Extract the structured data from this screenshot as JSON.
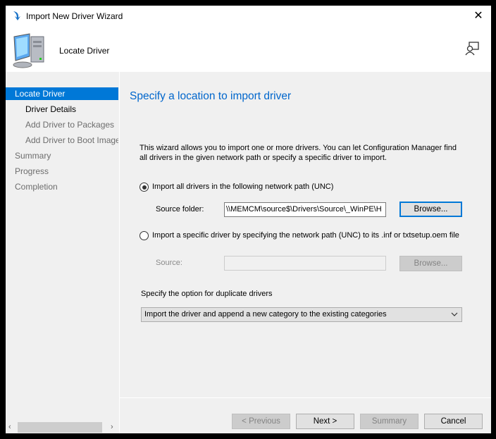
{
  "window": {
    "title": "Import New Driver Wizard",
    "close_icon": "close-icon"
  },
  "header": {
    "title": "Locate Driver",
    "feedback_icon": "feedback-icon"
  },
  "nav": {
    "items": [
      {
        "label": "Locate Driver",
        "state": "active"
      },
      {
        "label": "Driver Details",
        "state": "sub-current"
      },
      {
        "label": "Add Driver to Packages",
        "state": "sub"
      },
      {
        "label": "Add Driver to Boot Images",
        "state": "sub"
      },
      {
        "label": "Summary",
        "state": "top"
      },
      {
        "label": "Progress",
        "state": "top"
      },
      {
        "label": "Completion",
        "state": "top"
      }
    ]
  },
  "main": {
    "heading": "Specify a location to import driver",
    "description": "This wizard allows you to import one or more drivers. You can let Configuration Manager find all drivers in the given network path or specify a specific driver to import.",
    "option_all": {
      "label": "Import all drivers in the following network path (UNC)",
      "selected": true
    },
    "source_folder_label": "Source folder:",
    "source_folder_value": "\\\\MEMCM\\source$\\Drivers\\Source\\_WinPE\\H",
    "browse1": "Browse...",
    "option_specific": {
      "label": "Import a specific driver by specifying the network path (UNC) to its .inf or txtsetup.oem file",
      "selected": false
    },
    "source_label": "Source:",
    "source_value": "",
    "browse2": "Browse...",
    "duplicate_label": "Specify the option for duplicate drivers",
    "duplicate_value": "Import the driver and append a new category to the existing categories"
  },
  "footer": {
    "previous": "< Previous",
    "next": "Next >",
    "summary": "Summary",
    "cancel": "Cancel"
  },
  "colors": {
    "accent": "#0078d7",
    "heading": "#0066cc"
  }
}
